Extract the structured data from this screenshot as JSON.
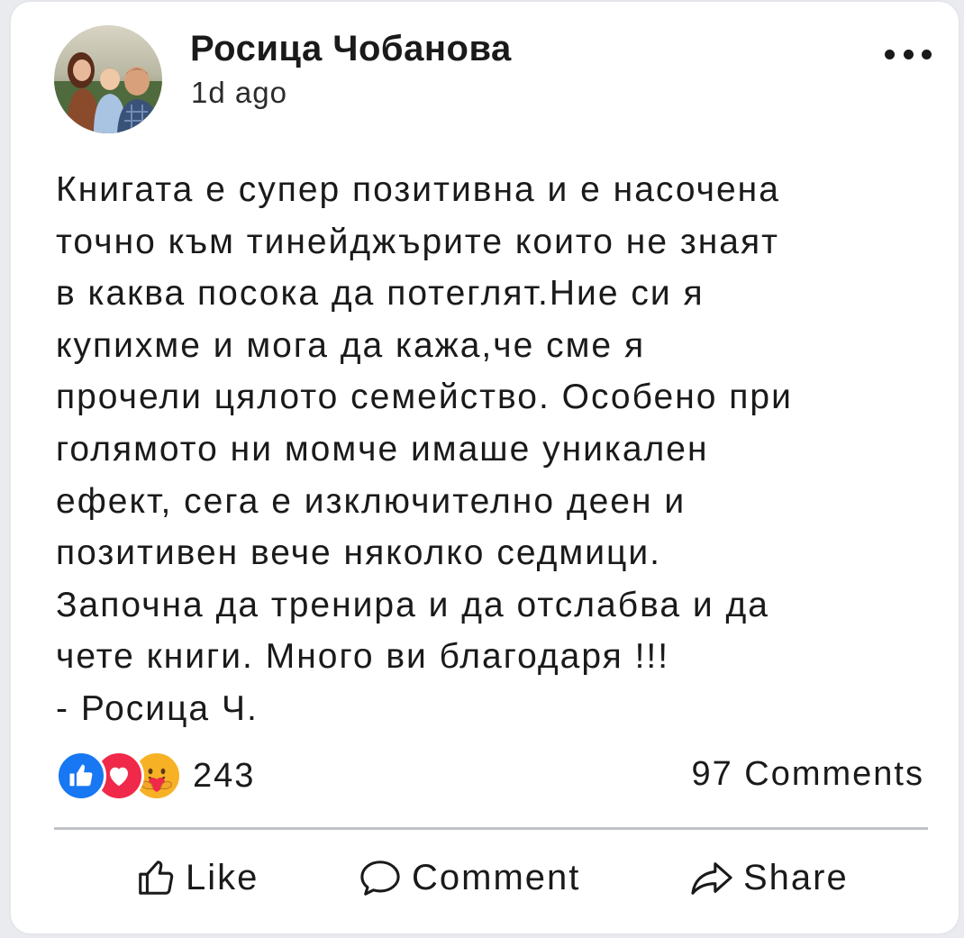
{
  "post": {
    "author": "Росица Чобанова",
    "time": "1d ago",
    "more_icon": "more-dots-icon",
    "body_lines": [
      "Книгата е супер позитивна и е насочена",
      "точно към тинейджърите които не знаят",
      "в каква посока да потеглят.Ние си я",
      "купихме и мога да кажа,че сме я",
      "прочели цялото семейство. Особено при",
      "голямото ни момче имаше уникален",
      "ефект, сега е изключително деен и",
      "позитивен вече няколко седмици.",
      "Започна да тренира и да отслабва и да",
      "чете книги. Много ви благодаря !!!",
      "- Росица Ч."
    ]
  },
  "stats": {
    "reaction_icons": [
      "like-reaction-icon",
      "love-reaction-icon",
      "care-reaction-icon"
    ],
    "reaction_count": "243",
    "comments": "97 Comments"
  },
  "actions": {
    "like": "Like",
    "comment": "Comment",
    "share": "Share"
  },
  "colors": {
    "like_blue": "#1877f2",
    "love_red": "#f02849",
    "care_yellow": "#f7b125",
    "divider": "#bfc2c6"
  }
}
